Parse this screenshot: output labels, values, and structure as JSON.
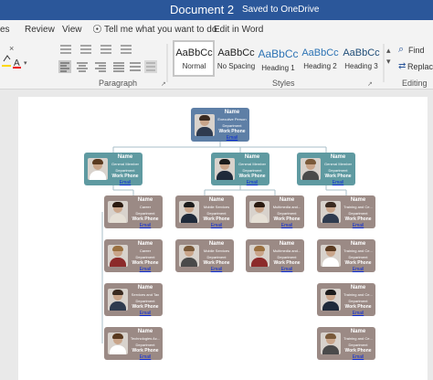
{
  "titlebar": {
    "title": "Document 2",
    "saved": "Saved to OneDrive"
  },
  "tabs": [
    "es",
    "Review",
    "View",
    "Tell me what you want to do",
    "Edit in Word"
  ],
  "ribbon": {
    "groups": {
      "paragraph": "Paragraph",
      "styles": "Styles",
      "editing": "Editing"
    },
    "styles": [
      {
        "sample": "AaBbCc",
        "label": "Normal"
      },
      {
        "sample": "AaBbCc",
        "label": "No Spacing"
      },
      {
        "sample": "AaBbCc",
        "label": "Heading 1"
      },
      {
        "sample": "AaBbCc",
        "label": "Heading 2"
      },
      {
        "sample": "AaBbCc",
        "label": "Heading 3"
      }
    ],
    "find": "Find",
    "replace": "Replace"
  },
  "colors": {
    "titlebar": "#2b579a",
    "exec": "#5e7fa6",
    "manager": "#5f9aa1",
    "staff": "#9b8a85",
    "email": "#0a2bd6"
  },
  "org": {
    "exec": {
      "name": "Name",
      "title": "Executive Person",
      "dept": "Department",
      "phone": "Work Phone",
      "email": "Email"
    },
    "managers": [
      {
        "name": "Name",
        "title": "General Member",
        "dept": "Department",
        "phone": "Work Phone",
        "email": "Email"
      },
      {
        "name": "Name",
        "title": "General Member",
        "dept": "Department",
        "phone": "Work Phone",
        "email": "Email"
      },
      {
        "name": "Name",
        "title": "General Member",
        "dept": "Department",
        "phone": "Work Phone",
        "email": "Email"
      }
    ],
    "staff": [
      {
        "name": "Name",
        "title": "Career",
        "dept": "Department",
        "phone": "Work Phone",
        "email": "Email"
      },
      {
        "name": "Name",
        "title": "Career",
        "dept": "Department",
        "phone": "Work Phone",
        "email": "Email"
      },
      {
        "name": "Name",
        "title": "Services and Tax",
        "dept": "Department",
        "phone": "Work Phone",
        "email": "Email"
      },
      {
        "name": "Name",
        "title": "Technologies Ac...",
        "dept": "Department",
        "phone": "Work Phone",
        "email": "Email"
      },
      {
        "name": "Name",
        "title": "Mobile Services",
        "dept": "Department",
        "phone": "Work Phone",
        "email": "Email"
      },
      {
        "name": "Name",
        "title": "Mobile Services",
        "dept": "Department",
        "phone": "Work Phone",
        "email": "Email"
      },
      {
        "name": "Name",
        "title": "Multimedia and...",
        "dept": "Department",
        "phone": "Work Phone",
        "email": "Email"
      },
      {
        "name": "Name",
        "title": "Multimedia and...",
        "dept": "Department",
        "phone": "Work Phone",
        "email": "Email"
      },
      {
        "name": "Name",
        "title": "Training and Ce...",
        "dept": "Department",
        "phone": "Work Phone",
        "email": "Email"
      },
      {
        "name": "Name",
        "title": "Training and Ce...",
        "dept": "Department",
        "phone": "Work Phone",
        "email": "Email"
      },
      {
        "name": "Name",
        "title": "Training and Ce...",
        "dept": "Department",
        "phone": "Work Phone",
        "email": "Email"
      },
      {
        "name": "Name",
        "title": "Training and Ce...",
        "dept": "Department",
        "phone": "Work Phone",
        "email": "Email"
      }
    ]
  }
}
